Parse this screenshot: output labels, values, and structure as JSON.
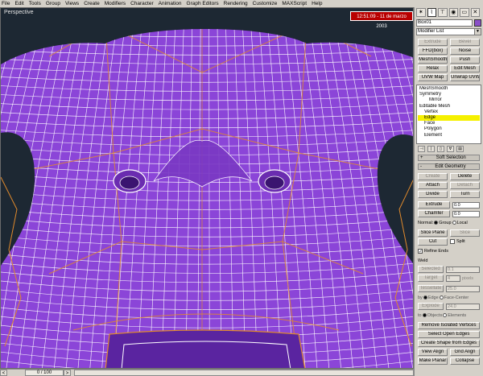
{
  "menubar": [
    "File",
    "Edit",
    "Tools",
    "Group",
    "Views",
    "Create",
    "Modifiers",
    "Character",
    "Animation",
    "Graph Editors",
    "Rendering",
    "Customize",
    "MAXScript",
    "Help"
  ],
  "viewport": {
    "label": "Perspective",
    "timestamp": "12:51:09 - 11 de marzo 2003",
    "background": "#1d2833",
    "mesh_color": "#8b45d8"
  },
  "statusbar": {
    "frame": "0 / 100",
    "prev": "<",
    "next": ">"
  },
  "command_panel": {
    "tabs": [
      "create-icon",
      "modify-icon",
      "hierarchy-icon",
      "motion-icon",
      "display-icon",
      "utilities-icon"
    ],
    "tab_glyphs": [
      "✶",
      "⌇",
      "⊤",
      "◉",
      "▭",
      "✕"
    ],
    "object_name": "Box01",
    "object_color": "#8a4fc8",
    "modifier_list": "Modifier List",
    "modifier_buttons": [
      "Extrude",
      "Bevel",
      "FFD(box)",
      "Noise",
      "MeshSmooth",
      "Push",
      "Relax",
      "Edit Mesh",
      "UVW Map",
      "Unwrap UVW"
    ],
    "stack": [
      {
        "label": "MeshSmooth",
        "level": 0
      },
      {
        "label": "Symmetry",
        "level": 0
      },
      {
        "label": "Mirror",
        "level": 2
      },
      {
        "label": "Editable Mesh",
        "level": 0
      },
      {
        "label": "Vertex",
        "level": 1
      },
      {
        "label": "Edge",
        "level": 1
      },
      {
        "label": "Face",
        "level": 1
      },
      {
        "label": "Polygon",
        "level": 1
      },
      {
        "label": "Element",
        "level": 1
      }
    ],
    "stack_tools": [
      "⊣",
      "|",
      "▯",
      "∀",
      "▤"
    ],
    "rollouts": {
      "soft_selection": "Soft Selection",
      "edit_geometry": "Edit Geometry",
      "soft_sign": "+",
      "edit_sign": "-"
    },
    "create_delete": [
      "Create",
      "Delete"
    ],
    "attach_detach": [
      "Attach",
      "Detach"
    ],
    "divide_turn": [
      "Divide",
      "Turn"
    ],
    "extrude": {
      "label": "Extrude",
      "value": "0.0"
    },
    "chamfer": {
      "label": "Chamfer",
      "value": "0.0"
    },
    "normal": {
      "label": "Normal:",
      "group": "Group",
      "local": "Local"
    },
    "slice_plane": [
      "Slice Plane",
      "Slice"
    ],
    "cut_split": [
      "Cut",
      "Split"
    ],
    "refine_ends": "Refine Ends",
    "weld": {
      "title": "Weld",
      "selected_label": "Selected",
      "selected_value": "0.1",
      "target_label": "Target",
      "target_value": "4",
      "target_unit": "pixels"
    },
    "tessellate": {
      "label": "Tessellate",
      "value": "25.0",
      "by_label": "by",
      "edge": "Edge",
      "face_center": "Face-Center"
    },
    "explode": {
      "label": "Explode",
      "value": "24.0",
      "by_label": "to",
      "objects": "Objects",
      "elements": "Elements"
    },
    "bottom_buttons": [
      "Remove Isolated Vertices",
      "Select Open Edges",
      "Create Shape from Edges"
    ],
    "view_align": [
      "View Align",
      "Grid Align"
    ],
    "make_planar": [
      "Make Planar",
      "Collapse"
    ]
  }
}
